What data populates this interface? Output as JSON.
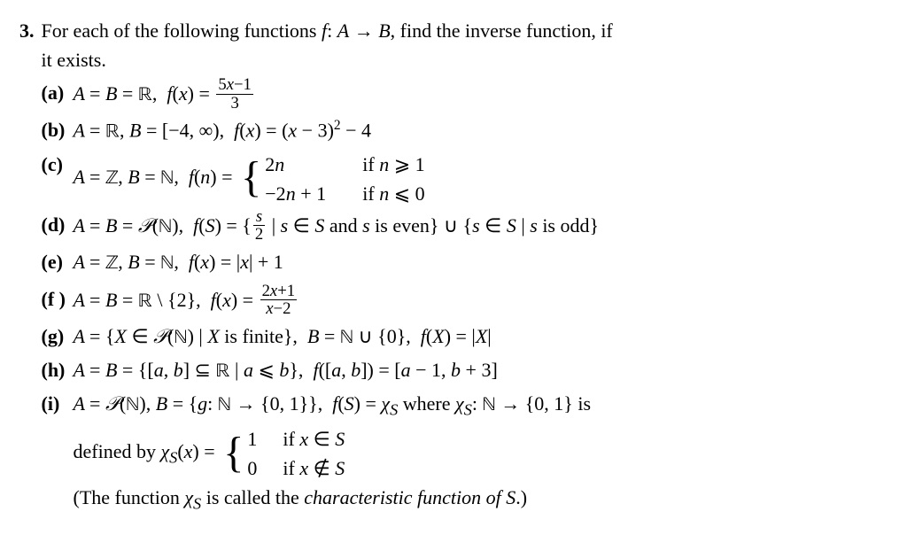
{
  "problem_number": "3.",
  "intro_text": "For each of the following functions f: A → B, find the inverse function, if it exists.",
  "parts": {
    "a": {
      "label": "(a)",
      "text_html": "A = B = ℝ, f(x) = (5x−1)/3"
    },
    "b": {
      "label": "(b)",
      "text_html": "A = ℝ, B = [−4, ∞), f(x) = (x − 3)² − 4"
    },
    "c": {
      "label": "(c)",
      "prefix": "A = ℤ, B = ℕ, f(n) = ",
      "case1_expr": "2n",
      "case1_cond": "if n ⩾ 1",
      "case2_expr": "−2n + 1",
      "case2_cond": "if n ⩽ 0"
    },
    "d": {
      "label": "(d)",
      "text_html": "A = B = 𝒫(ℕ), f(S) = { s/2 | s ∈ S and s is even} ∪ {s ∈ S | s is odd}"
    },
    "e": {
      "label": "(e)",
      "text_html": "A = ℤ, B = ℕ, f(x) = |x| + 1"
    },
    "f": {
      "label": "(f )",
      "text_html": "A = B = ℝ \\ {2}, f(x) = (2x+1)/(x−2)"
    },
    "g": {
      "label": "(g)",
      "text_html": "A = {X ∈ 𝒫(ℕ) | X is finite}, B = ℕ ∪ {0}, f(X) = |X|"
    },
    "h": {
      "label": "(h)",
      "text_html": "A = B = {[a, b] ⊆ ℝ | a ⩽ b}, f([a, b]) = [a − 1, b + 3]"
    },
    "i": {
      "label": "(i)",
      "line1": "A = 𝒫(ℕ), B = {g: ℕ → {0, 1}}, f(S) = χ_S where χ_S: ℕ → {0, 1} is",
      "defined_by": "defined by χ_S(x) = ",
      "case1_expr": "1",
      "case1_cond": "if x ∈ S",
      "case2_expr": "0",
      "case2_cond": "if x ∉ S",
      "note": "(The function χ_S is called the characteristic function of S.)"
    }
  },
  "chart_data": null
}
